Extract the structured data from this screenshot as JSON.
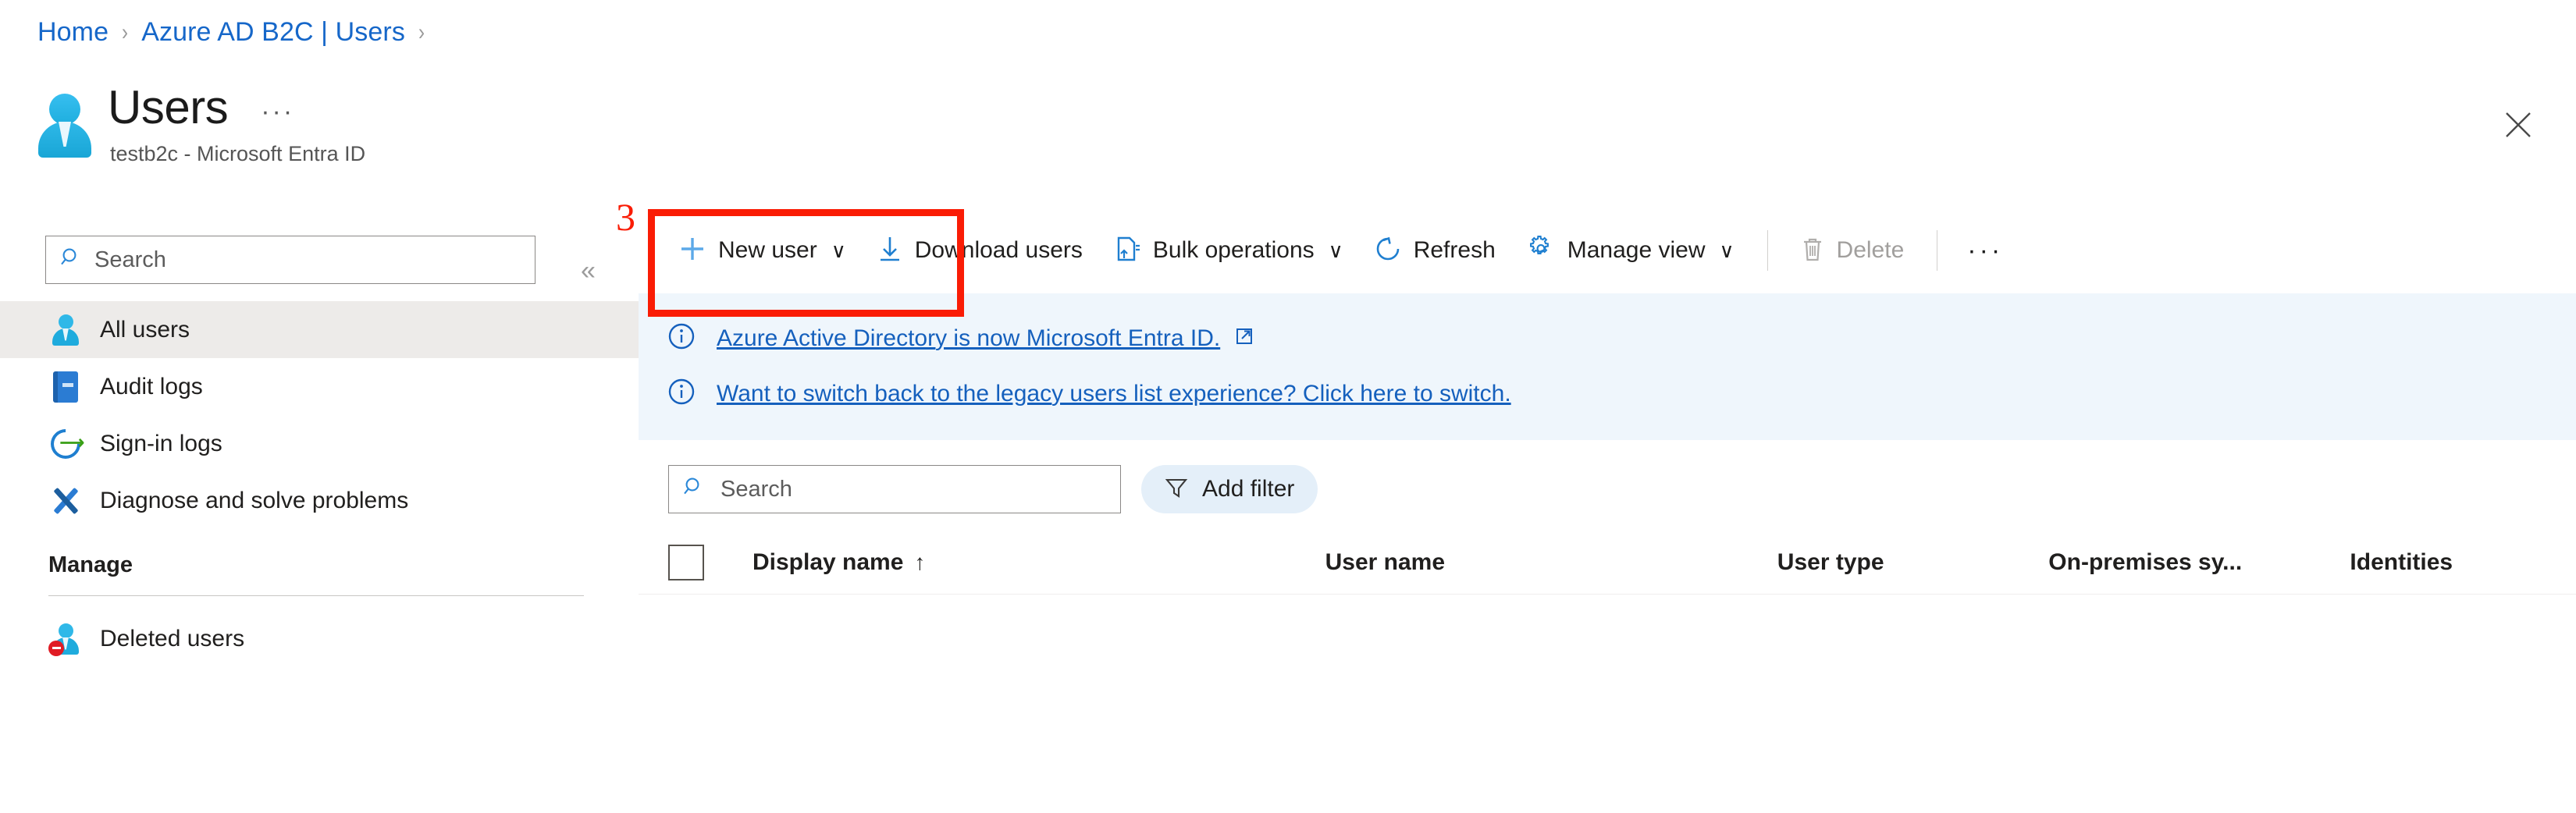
{
  "breadcrumb": {
    "items": [
      "Home",
      "Azure AD B2C | Users"
    ],
    "separator": "›"
  },
  "header": {
    "title": "Users",
    "subtitle": "testb2c - Microsoft Entra ID",
    "ellipsis": "···",
    "avatar_icon": "user-avatar-icon",
    "close_icon": "close-icon"
  },
  "sidebar": {
    "search": {
      "placeholder": "Search",
      "value": "",
      "icon": "search-icon"
    },
    "collapse_icon": "«",
    "items": [
      {
        "label": "All users",
        "icon": "person-icon",
        "selected": true
      },
      {
        "label": "Audit logs",
        "icon": "book-icon",
        "selected": false
      },
      {
        "label": "Sign-in logs",
        "icon": "sign-in-icon",
        "selected": false
      },
      {
        "label": "Diagnose and solve problems",
        "icon": "tools-icon",
        "selected": false
      }
    ],
    "group_title": "Manage",
    "group_items": [
      {
        "label": "Deleted users",
        "icon": "person-deleted-icon",
        "selected": false
      }
    ]
  },
  "toolbar": {
    "new_user": {
      "label": "New user",
      "icon": "plus-icon",
      "chevron": "∨"
    },
    "download_users": {
      "label": "Download users",
      "icon": "download-icon"
    },
    "bulk_operations": {
      "label": "Bulk operations",
      "icon": "bulk-operations-icon",
      "chevron": "∨"
    },
    "refresh": {
      "label": "Refresh",
      "icon": "refresh-icon"
    },
    "manage_view": {
      "label": "Manage view",
      "icon": "gear-icon",
      "chevron": "∨"
    },
    "delete": {
      "label": "Delete",
      "icon": "trash-icon",
      "disabled": true
    },
    "more": "···"
  },
  "annotation": {
    "number": "3",
    "color": "#fa1c05",
    "target": "New user"
  },
  "banners": [
    {
      "icon": "info-icon",
      "text": "Azure Active Directory is now Microsoft Entra ID.",
      "external_link_icon": "external-link-icon"
    },
    {
      "icon": "info-icon",
      "text": "Want to switch back to the legacy users list experience? Click here to switch.",
      "external_link_icon": ""
    }
  ],
  "filters": {
    "search": {
      "placeholder": "Search",
      "value": "",
      "icon": "search-icon"
    },
    "add_filter": {
      "label": "Add filter",
      "icon": "filter-icon"
    }
  },
  "table": {
    "select_all_checked": false,
    "columns": [
      {
        "label": "Display name",
        "sort": "↑"
      },
      {
        "label": "User name",
        "sort": ""
      },
      {
        "label": "User type",
        "sort": ""
      },
      {
        "label": "On-premises sy...",
        "sort": ""
      },
      {
        "label": "Identities",
        "sort": ""
      }
    ],
    "rows": []
  },
  "colors": {
    "link": "#1667c9",
    "banner_bg": "#eff6fc",
    "selected_bg": "#edebe9",
    "accent": "#0078d4",
    "annotation": "#fa1c05"
  }
}
